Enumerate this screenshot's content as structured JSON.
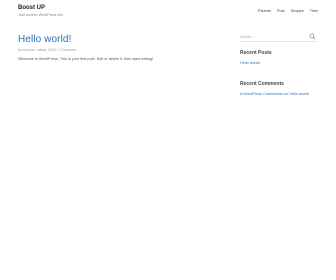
{
  "site": {
    "title": "Boost UP",
    "tagline": "Just another WordPress site"
  },
  "nav": {
    "items": [
      "Parents",
      "Post",
      "Shoppe",
      "Tires"
    ]
  },
  "post": {
    "title": "Hello world!",
    "meta": "by cmsbox / admin, 2016 / 1 Comment",
    "content": "Welcome to WordPress. This is your first post. Edit or delete it, then start writing!"
  },
  "sidebar": {
    "search_placeholder": "Search …",
    "recent_posts_title": "Recent Posts",
    "recent_posts": [
      "Hello world!"
    ],
    "recent_comments_title": "Recent Comments",
    "recent_comments": [
      "A WordPress Commenter on Hello world!"
    ]
  },
  "colors": {
    "link": "#2f6fb3",
    "title": "#222222",
    "muted": "#999999"
  }
}
